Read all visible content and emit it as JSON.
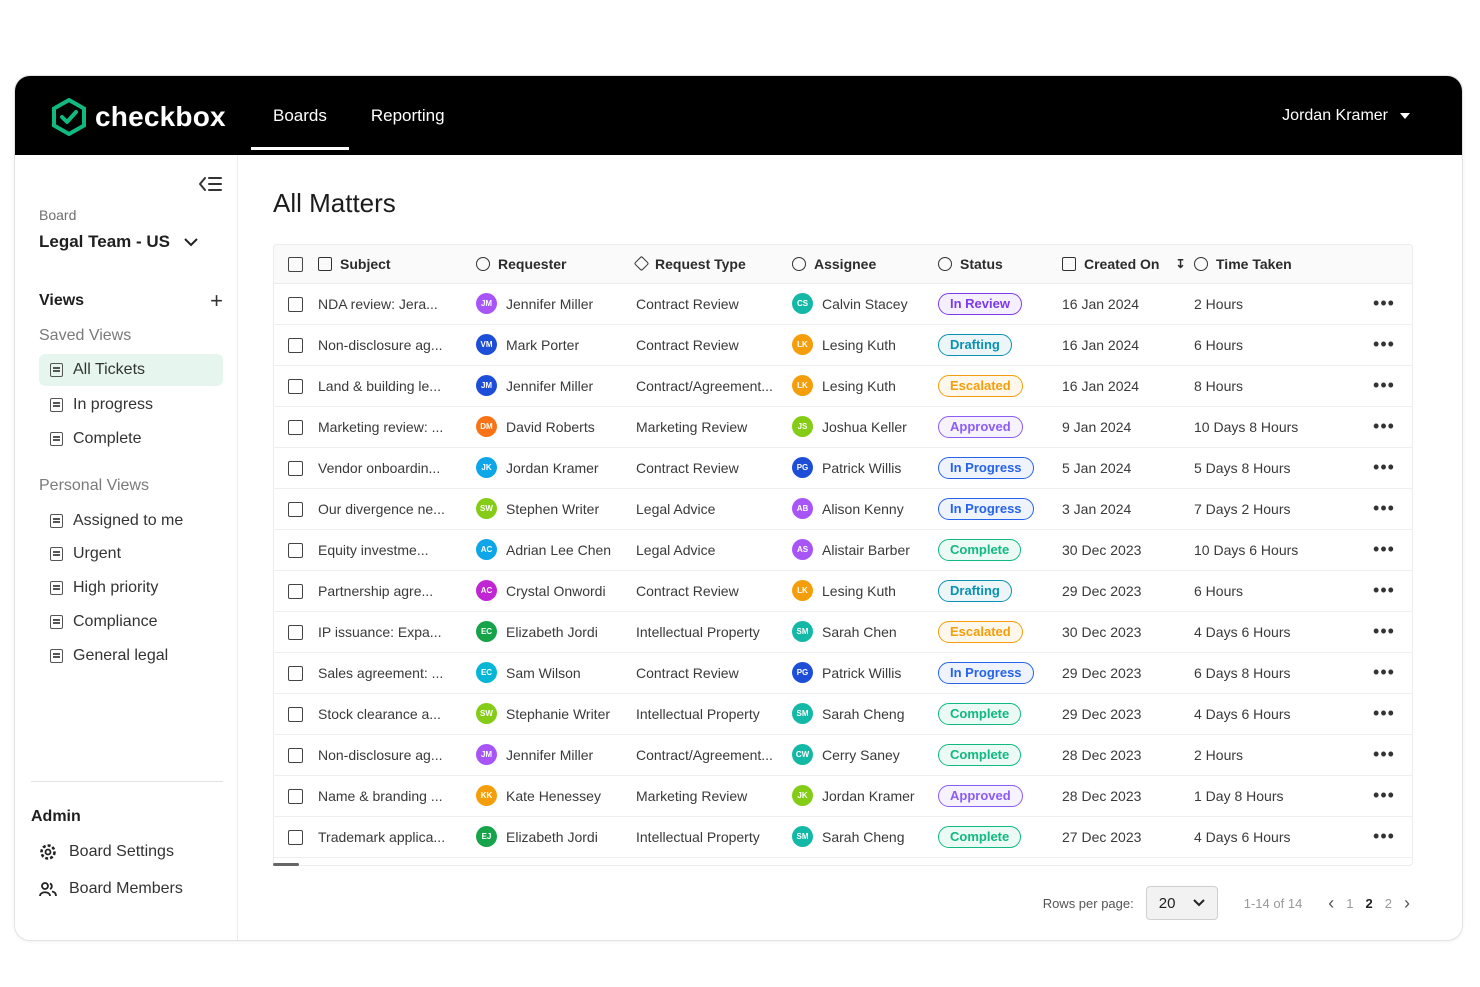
{
  "app": {
    "brand": "checkbox",
    "brand_color": "#10b981"
  },
  "nav": {
    "tabs": [
      {
        "label": "Boards",
        "active": true
      },
      {
        "label": "Reporting",
        "active": false
      }
    ]
  },
  "user": {
    "name": "Jordan Kramer"
  },
  "sidebar": {
    "board_label": "Board",
    "board_name": "Legal Team - US",
    "views_label": "Views",
    "saved_views_label": "Saved Views",
    "saved_views": [
      {
        "label": "All Tickets",
        "active": true
      },
      {
        "label": "In progress"
      },
      {
        "label": "Complete"
      }
    ],
    "personal_views_label": "Personal Views",
    "personal_views": [
      {
        "label": "Assigned to me"
      },
      {
        "label": "Urgent"
      },
      {
        "label": "High priority"
      },
      {
        "label": "Compliance"
      },
      {
        "label": "General legal"
      }
    ],
    "admin_label": "Admin",
    "admin_items": [
      {
        "label": "Board Settings",
        "icon": "gear-icon"
      },
      {
        "label": "Board Members",
        "icon": "users-icon"
      }
    ]
  },
  "main": {
    "title": "All Matters",
    "columns": {
      "subject": "Subject",
      "requester": "Requester",
      "request_type": "Request Type",
      "assignee": "Assignee",
      "status": "Status",
      "created_on": "Created On",
      "time_taken": "Time Taken"
    },
    "status_colors": {
      "In Review": "#7c3aed",
      "Drafting": "#0891b2",
      "Escalated": "#f59e0b",
      "Approved": "#8b5cf6",
      "In Progress": "#2563eb",
      "Complete": "#10b981"
    },
    "rows": [
      {
        "subject": "NDA review: Jera...",
        "requester": {
          "name": "Jennifer Miller",
          "initials": "JM",
          "color": "#a855f7"
        },
        "request_type": "Contract Review",
        "assignee": {
          "name": "Calvin Stacey",
          "initials": "CS",
          "color": "#14b8a6"
        },
        "status": "In Review",
        "created_on": "16 Jan 2024",
        "time_taken": "2 Hours"
      },
      {
        "subject": "Non-disclosure ag...",
        "requester": {
          "name": "Mark Porter",
          "initials": "VM",
          "color": "#1d4ed8"
        },
        "request_type": "Contract Review",
        "assignee": {
          "name": "Lesing Kuth",
          "initials": "LK",
          "color": "#f59e0b"
        },
        "status": "Drafting",
        "created_on": "16 Jan 2024",
        "time_taken": "6 Hours"
      },
      {
        "subject": "Land & building le...",
        "requester": {
          "name": "Jennifer Miller",
          "initials": "JM",
          "color": "#1d4ed8"
        },
        "request_type": "Contract/Agreement...",
        "assignee": {
          "name": "Lesing Kuth",
          "initials": "LK",
          "color": "#f59e0b"
        },
        "status": "Escalated",
        "created_on": "16 Jan 2024",
        "time_taken": "8 Hours"
      },
      {
        "subject": "Marketing review: ...",
        "requester": {
          "name": "David Roberts",
          "initials": "DM",
          "color": "#f97316"
        },
        "request_type": "Marketing Review",
        "assignee": {
          "name": "Joshua Keller",
          "initials": "JS",
          "color": "#84cc16"
        },
        "status": "Approved",
        "created_on": "9 Jan 2024",
        "time_taken": "10 Days 8 Hours"
      },
      {
        "subject": "Vendor onboardin...",
        "requester": {
          "name": "Jordan Kramer",
          "initials": "JK",
          "color": "#0ea5e9"
        },
        "request_type": "Contract Review",
        "assignee": {
          "name": "Patrick Willis",
          "initials": "PG",
          "color": "#1d4ed8"
        },
        "status": "In Progress",
        "created_on": "5 Jan 2024",
        "time_taken": "5 Days 8 Hours"
      },
      {
        "subject": "Our divergence ne...",
        "requester": {
          "name": "Stephen Writer",
          "initials": "SW",
          "color": "#84cc16"
        },
        "request_type": "Legal Advice",
        "assignee": {
          "name": "Alison Kenny",
          "initials": "AB",
          "color": "#a855f7"
        },
        "status": "In Progress",
        "created_on": "3 Jan 2024",
        "time_taken": "7 Days 2 Hours"
      },
      {
        "subject": "Equity investme...",
        "requester": {
          "name": "Adrian Lee Chen",
          "initials": "AC",
          "color": "#0ea5e9"
        },
        "request_type": "Legal Advice",
        "assignee": {
          "name": "Alistair Barber",
          "initials": "AS",
          "color": "#a855f7"
        },
        "status": "Complete",
        "created_on": "30 Dec 2023",
        "time_taken": "10 Days 6 Hours"
      },
      {
        "subject": "Partnership agre...",
        "requester": {
          "name": "Crystal Onwordi",
          "initials": "AC",
          "color": "#c026d3"
        },
        "request_type": "Contract Review",
        "assignee": {
          "name": "Lesing Kuth",
          "initials": "LK",
          "color": "#f59e0b"
        },
        "status": "Drafting",
        "created_on": "29 Dec 2023",
        "time_taken": "6 Hours"
      },
      {
        "subject": "IP issuance: Expa...",
        "requester": {
          "name": "Elizabeth Jordi",
          "initials": "EC",
          "color": "#16a34a"
        },
        "request_type": "Intellectual Property",
        "assignee": {
          "name": "Sarah Chen",
          "initials": "SM",
          "color": "#14b8a6"
        },
        "status": "Escalated",
        "created_on": "30 Dec 2023",
        "time_taken": "4 Days 6 Hours"
      },
      {
        "subject": "Sales agreement: ...",
        "requester": {
          "name": "Sam Wilson",
          "initials": "EC",
          "color": "#06b6d4"
        },
        "request_type": "Contract Review",
        "assignee": {
          "name": "Patrick Willis",
          "initials": "PG",
          "color": "#1d4ed8"
        },
        "status": "In Progress",
        "created_on": "29 Dec 2023",
        "time_taken": "6 Days 8 Hours"
      },
      {
        "subject": "Stock clearance a...",
        "requester": {
          "name": "Stephanie Writer",
          "initials": "SW",
          "color": "#84cc16"
        },
        "request_type": "Intellectual Property",
        "assignee": {
          "name": "Sarah Cheng",
          "initials": "SM",
          "color": "#14b8a6"
        },
        "status": "Complete",
        "created_on": "29 Dec 2023",
        "time_taken": "4 Days 6 Hours"
      },
      {
        "subject": "Non-disclosure ag...",
        "requester": {
          "name": "Jennifer Miller",
          "initials": "JM",
          "color": "#a855f7"
        },
        "request_type": "Contract/Agreement...",
        "assignee": {
          "name": "Cerry Saney",
          "initials": "CW",
          "color": "#14b8a6"
        },
        "status": "Complete",
        "created_on": "28 Dec 2023",
        "time_taken": "2 Hours"
      },
      {
        "subject": "Name & branding ...",
        "requester": {
          "name": "Kate Henessey",
          "initials": "KK",
          "color": "#f59e0b"
        },
        "request_type": "Marketing Review",
        "assignee": {
          "name": "Jordan Kramer",
          "initials": "JK",
          "color": "#84cc16"
        },
        "status": "Approved",
        "created_on": "28 Dec 2023",
        "time_taken": "1 Day 8 Hours"
      },
      {
        "subject": "Trademark applica...",
        "requester": {
          "name": "Elizabeth Jordi",
          "initials": "EJ",
          "color": "#16a34a"
        },
        "request_type": "Intellectual Property",
        "assignee": {
          "name": "Sarah Cheng",
          "initials": "SM",
          "color": "#14b8a6"
        },
        "status": "Complete",
        "created_on": "27 Dec 2023",
        "time_taken": "4 Days 6 Hours"
      }
    ]
  },
  "pagination": {
    "rows_per_page_label": "Rows per page:",
    "rows_per_page": "20",
    "range": "1-14 of 14",
    "pages": [
      "1",
      "2",
      "2"
    ],
    "current_page": "2"
  }
}
